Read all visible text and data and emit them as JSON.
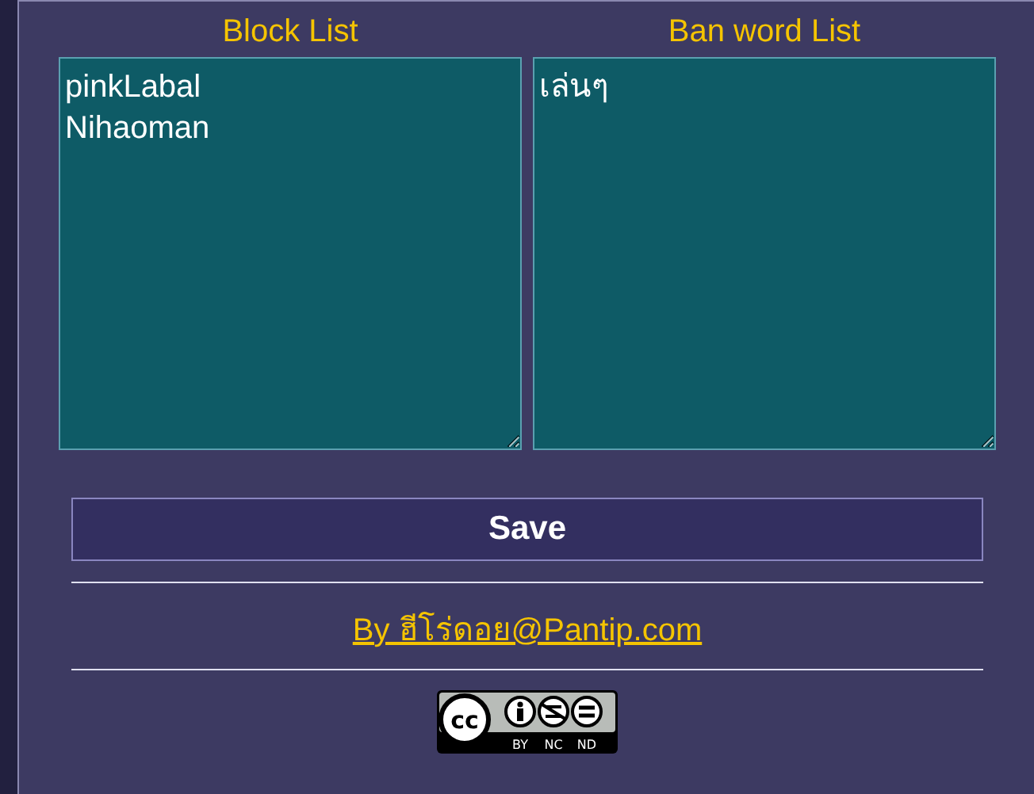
{
  "lists": [
    {
      "heading": "Block List",
      "value": "pinkLabal\nNihaoman"
    },
    {
      "heading": "Ban word List",
      "value": "เล่นๆ"
    }
  ],
  "save_button": {
    "label": "Save"
  },
  "credit_link": "By ฮีโร่ดอย@Pantip.com",
  "license_badge": {
    "logo": "cc",
    "terms": [
      "BY",
      "NC",
      "ND"
    ]
  }
}
